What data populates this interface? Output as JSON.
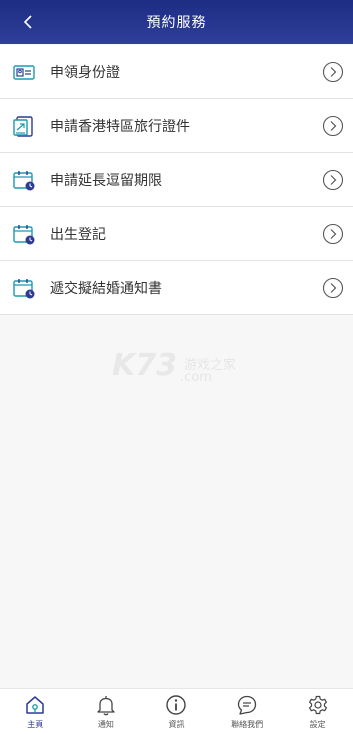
{
  "header": {
    "title": "預約服務"
  },
  "services": [
    {
      "label": "申領身份證",
      "icon": "id-card-icon"
    },
    {
      "label": "申請香港特區旅行證件",
      "icon": "travel-document-icon"
    },
    {
      "label": "申請延長逗留期限",
      "icon": "calendar-clock-icon"
    },
    {
      "label": "出生登記",
      "icon": "calendar-clock-icon"
    },
    {
      "label": "遞交擬結婚通知書",
      "icon": "calendar-clock-icon"
    }
  ],
  "watermark": {
    "brand": "K73",
    "cn": "游戏之家",
    "domain": ".com"
  },
  "tabs": [
    {
      "label": "主頁",
      "icon": "home-icon",
      "active": true
    },
    {
      "label": "通知",
      "icon": "bell-icon",
      "active": false
    },
    {
      "label": "資訊",
      "icon": "info-icon",
      "active": false
    },
    {
      "label": "聯絡我們",
      "icon": "chat-icon",
      "active": false
    },
    {
      "label": "設定",
      "icon": "gear-icon",
      "active": false
    }
  ],
  "colors": {
    "header": "#24348d",
    "accent_teal": "#1a9bb0",
    "accent_blue": "#2d3b91"
  }
}
